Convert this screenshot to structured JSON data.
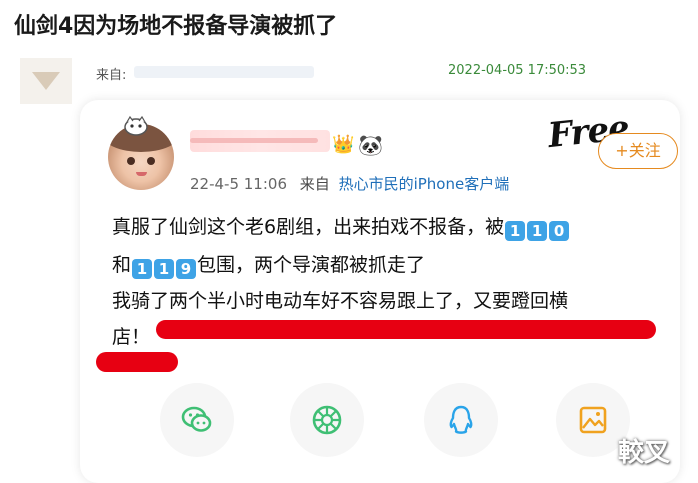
{
  "headline": "仙剑4因为场地不报备导演被抓了",
  "source": {
    "label": "来自:",
    "datetime": "2022-04-05 17:50:53"
  },
  "post": {
    "meta_date": "22-4-5 11:06",
    "meta_via": "来自",
    "meta_source": "热心市民的iPhone客户端",
    "sticker_text": "Free",
    "follow_label": "+关注",
    "line1_prefix": "真服了仙剑这个老6剧组，出来拍戏不报备，被",
    "line1_keys": [
      "1",
      "1",
      "0"
    ],
    "line2_prefix": "和",
    "line2_keys": [
      "1",
      "1",
      "9"
    ],
    "line2_suffix": "包围，两个导演都被抓走了",
    "line3": "我骑了两个半小时电动车好不容易跟上了，又要蹬回横",
    "line4": "店！"
  },
  "share_icons": [
    "wechat-icon",
    "moments-icon",
    "qq-icon",
    "save-image-icon"
  ],
  "watermark": "較叉",
  "colors": {
    "follow": "#e58a1f",
    "link": "#1f6fb9",
    "keycap": "#3ea3e6",
    "redact": "#e70012",
    "time": "#3a8a3a"
  }
}
